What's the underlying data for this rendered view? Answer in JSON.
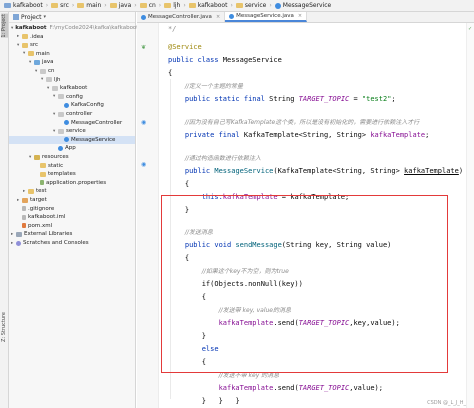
{
  "breadcrumbs": [
    "kafkaboot",
    "src",
    "main",
    "java",
    "cn",
    "ljh",
    "kafkaboot",
    "service",
    "MessageService"
  ],
  "left_strip": {
    "project_label": "1: Project",
    "structure_label": "Z: Structure"
  },
  "project_panel": {
    "title": "Project",
    "tree": [
      {
        "label": "kafkaboot",
        "extra": "F:\\myCode2024\\kafka\\kafkaboot",
        "icon": "folder-icon",
        "arrow": "▾"
      },
      {
        "label": ".idea",
        "extra": "",
        "icon": "folder-icon",
        "arrow": "▸"
      },
      {
        "label": "src",
        "extra": "",
        "icon": "folder-icon",
        "arrow": "▾"
      },
      {
        "label": "main",
        "extra": "",
        "icon": "folder-icon",
        "arrow": "▾"
      },
      {
        "label": "java",
        "extra": "",
        "icon": "source-folder-icon",
        "arrow": "▾"
      },
      {
        "label": "cn",
        "extra": "",
        "icon": "package-icon",
        "arrow": "▾"
      },
      {
        "label": "ljh",
        "extra": "",
        "icon": "package-icon",
        "arrow": "▾"
      },
      {
        "label": "kafkaboot",
        "extra": "",
        "icon": "package-icon",
        "arrow": "▾"
      },
      {
        "label": "config",
        "extra": "",
        "icon": "package-icon",
        "arrow": "▾"
      },
      {
        "label": "KafkaConfig",
        "extra": "",
        "icon": "class-icon",
        "arrow": ""
      },
      {
        "label": "controller",
        "extra": "",
        "icon": "package-icon",
        "arrow": "▾"
      },
      {
        "label": "MessageController",
        "extra": "",
        "icon": "class-icon",
        "arrow": ""
      },
      {
        "label": "service",
        "extra": "",
        "icon": "package-icon",
        "arrow": "▾"
      },
      {
        "label": "MessageService",
        "extra": "",
        "icon": "class-icon",
        "arrow": ""
      },
      {
        "label": "App",
        "extra": "",
        "icon": "class-icon",
        "arrow": ""
      },
      {
        "label": "resources",
        "extra": "",
        "icon": "resources-folder-icon",
        "arrow": "▾"
      },
      {
        "label": "static",
        "extra": "",
        "icon": "folder-icon",
        "arrow": ""
      },
      {
        "label": "templates",
        "extra": "",
        "icon": "folder-icon",
        "arrow": ""
      },
      {
        "label": "application.properties",
        "extra": "",
        "icon": "properties-file-icon",
        "arrow": ""
      },
      {
        "label": "test",
        "extra": "",
        "icon": "folder-icon",
        "arrow": "▸"
      },
      {
        "label": "target",
        "extra": "",
        "icon": "target-folder-icon",
        "arrow": "▸"
      },
      {
        "label": ".gitignore",
        "extra": "",
        "icon": "text-file-icon",
        "arrow": ""
      },
      {
        "label": "kafkaboot.iml",
        "extra": "",
        "icon": "text-file-icon",
        "arrow": ""
      },
      {
        "label": "pom.xml",
        "extra": "",
        "icon": "xml-file-icon",
        "arrow": ""
      },
      {
        "label": "External Libraries",
        "extra": "",
        "icon": "library-icon",
        "arrow": "▸"
      },
      {
        "label": "Scratches and Consoles",
        "extra": "",
        "icon": "scratch-icon",
        "arrow": "▸"
      }
    ]
  },
  "tabs": [
    {
      "label": "MessageController.java",
      "active": false
    },
    {
      "label": "MessageService.java",
      "active": true
    }
  ],
  "code": {
    "l0": "*/",
    "l2": "@Service",
    "l3a": "public class ",
    "l3b": "MessageService",
    "l4": "{",
    "l5": "//定义一个主题的常量",
    "l6a": "public static final ",
    "l6b": "String ",
    "l6c": "TARGET_TOPIC",
    "l6d": " = ",
    "l6e": "\"test2\"",
    "l6f": ";",
    "l8": "//因为没有自己写KafkaTemplate这个类，所以是没有初始化的，需要进行依赖注入才行",
    "l9a": "private final ",
    "l9b": "KafkaTemplate<String, String> ",
    "l9c": "kafkaTemplate",
    "l9d": ";",
    "l11": "//通过构造函数进行依赖注入",
    "l12a": "public ",
    "l12b": "MessageService",
    "l12c": "(KafkaTemplate<String, String> ",
    "l12d": "kafkaTemplate",
    "l12e": ")",
    "l13": "{",
    "l14a": "this.",
    "l14b": "kafkaTemplate",
    "l14c": " = kafkaTemplate;",
    "l15": "}",
    "l17": "//发送消息",
    "l18a": "public void ",
    "l18b": "sendMessage",
    "l18c": "(String key, String value)",
    "l19": "{",
    "l20": "//如果这个key不为空，则为true",
    "l21": "if(Objects.nonNull(key))",
    "l22": "{",
    "l23": "//发送带 key, value的消息",
    "l24a": "kafkaTemplate",
    "l24b": ".send(",
    "l24c": "TARGET_TOPIC",
    "l24d": ",key,value);",
    "l25": "}",
    "l26": "else",
    "l27": "{",
    "l28": "//发送不带 key 的消息",
    "l29a": "kafkaTemplate",
    "l29b": ".send(",
    "l29c": "TARGET_TOPIC",
    "l29d": ",value);",
    "l30": "}",
    "l31": "}",
    "l34": "}"
  },
  "watermark": "CSDN @_L_J_H_"
}
